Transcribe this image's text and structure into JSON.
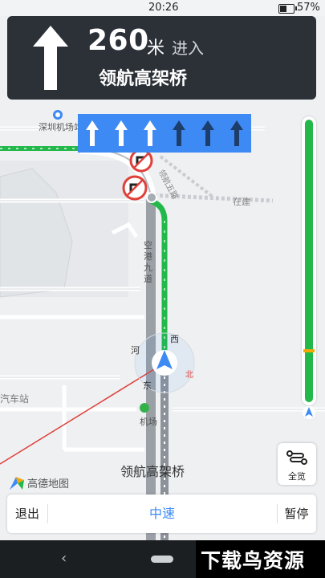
{
  "status_bar": {
    "time": "20:26",
    "battery": "57%",
    "battery_level": 0.57
  },
  "guidance": {
    "distance": "260",
    "unit": "米",
    "action": "进入",
    "road": "领航高架桥",
    "maneuver_icon": "straight-arrow-icon"
  },
  "lanes": [
    {
      "icon": "lane-straight-icon",
      "recommended": true
    },
    {
      "icon": "lane-straight-icon",
      "recommended": true
    },
    {
      "icon": "lane-straight-icon",
      "recommended": true
    },
    {
      "icon": "lane-straight-icon",
      "recommended": false
    },
    {
      "icon": "lane-straight-icon",
      "recommended": false
    },
    {
      "icon": "lane-straight-icon",
      "recommended": false
    }
  ],
  "map": {
    "labels": {
      "airport_station": "深圳机场站",
      "road_east": "领航五路",
      "under_construction": "在建",
      "kg_road": "空港九道",
      "west": "西",
      "river": "河",
      "bus_station": "汽车站",
      "airport": "机场",
      "east": "东",
      "north": "北",
      "road_bottom": "领航高架桥"
    }
  },
  "progress": {
    "remaining_fraction": 1.0,
    "colors": {
      "smooth": "#22b94a",
      "slow": "#f5a70a"
    }
  },
  "overview_button": {
    "label": "全览",
    "icon": "route-overview-icon"
  },
  "brand": {
    "name": "高德地图"
  },
  "bottom_bar": {
    "exit": "退出",
    "speed_mode": "中速",
    "pause": "暂停"
  },
  "watermark": "下载鸟资源",
  "colors": {
    "accent": "#3e8af5",
    "route": "#22b94a",
    "card": "#2c3138"
  }
}
